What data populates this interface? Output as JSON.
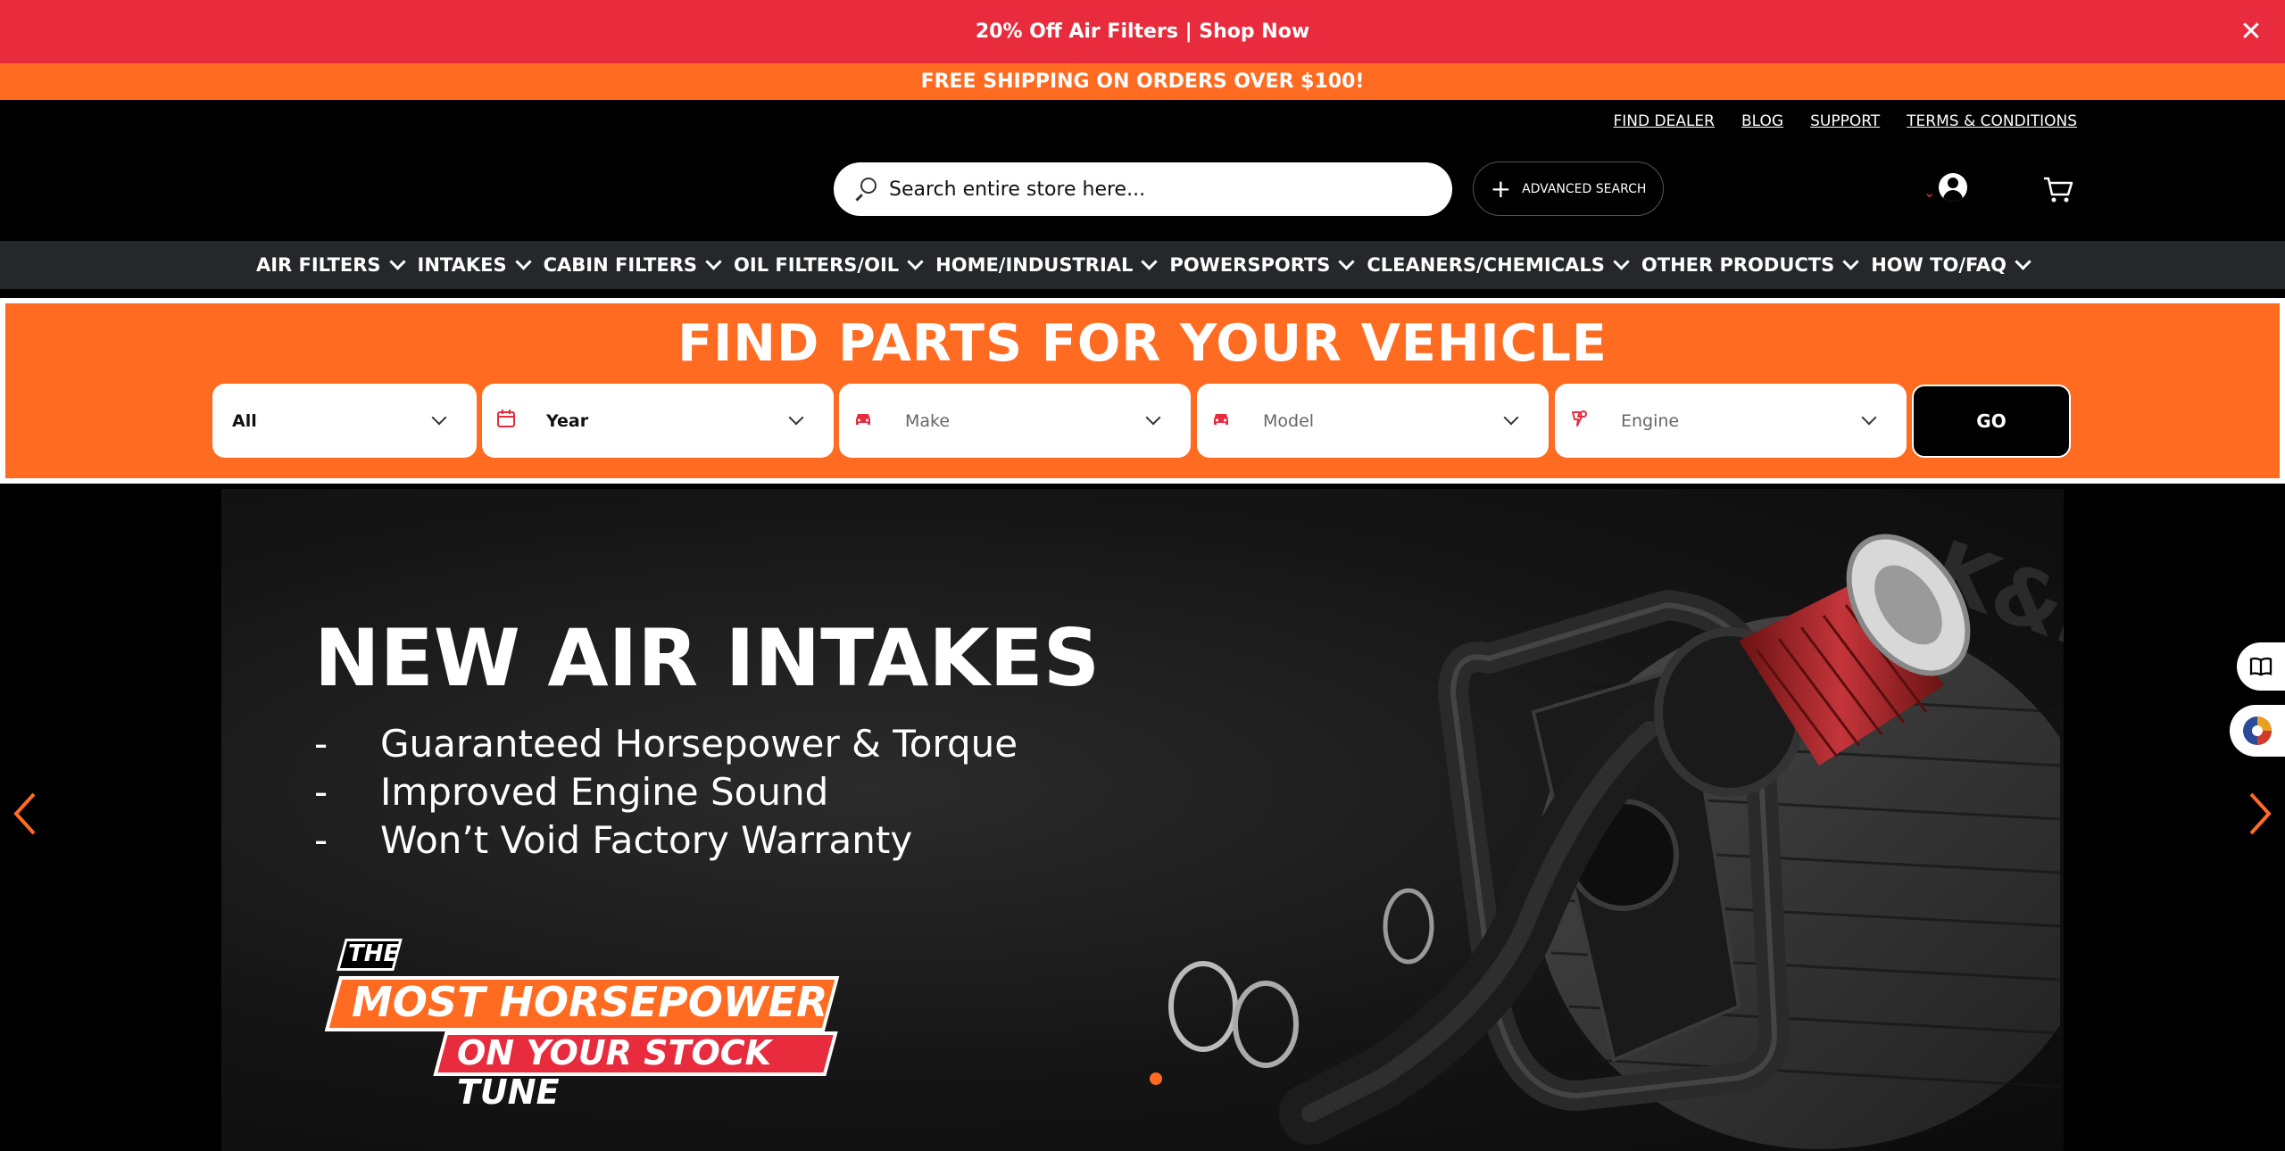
{
  "promo": {
    "text": "20% Off Air Filters  |  Shop Now",
    "close_symbol": "✕"
  },
  "shipping": {
    "text": "FREE SHIPPING ON ORDERS OVER $100!"
  },
  "toplinks": [
    "FIND DEALER",
    "BLOG",
    "SUPPORT",
    "TERMS & CONDITIONS"
  ],
  "search": {
    "placeholder": "Search entire store here..."
  },
  "advanced_search": {
    "label": "ADVANCED SEARCH"
  },
  "nav": [
    "AIR FILTERS",
    "INTAKES",
    "CABIN FILTERS",
    "OIL FILTERS/OIL",
    "HOME/INDUSTRIAL",
    "POWERSPORTS",
    "CLEANERS/CHEMICALS",
    "OTHER PRODUCTS",
    "HOW TO/FAQ"
  ],
  "finder": {
    "title": "FIND PARTS FOR YOUR VEHICLE",
    "type_value": "All",
    "year_value": "Year",
    "make_placeholder": "Make",
    "model_placeholder": "Model",
    "engine_placeholder": "Engine",
    "go_label": "GO"
  },
  "hero": {
    "title": "NEW AIR INTAKES",
    "bullets": [
      "Guaranteed Horsepower & Torque",
      "Improved Engine Sound",
      "Won’t Void Factory Warranty"
    ],
    "bullet_marker": "-",
    "badge_line1": "THE",
    "badge_line2": "MOST HORSEPOWER",
    "badge_line3": "ON YOUR STOCK TUNE",
    "watermark": "K&N"
  },
  "colors": {
    "promo_red": "#e82c3e",
    "brand_orange": "#ff6b21",
    "nav_bg": "#26272b"
  }
}
